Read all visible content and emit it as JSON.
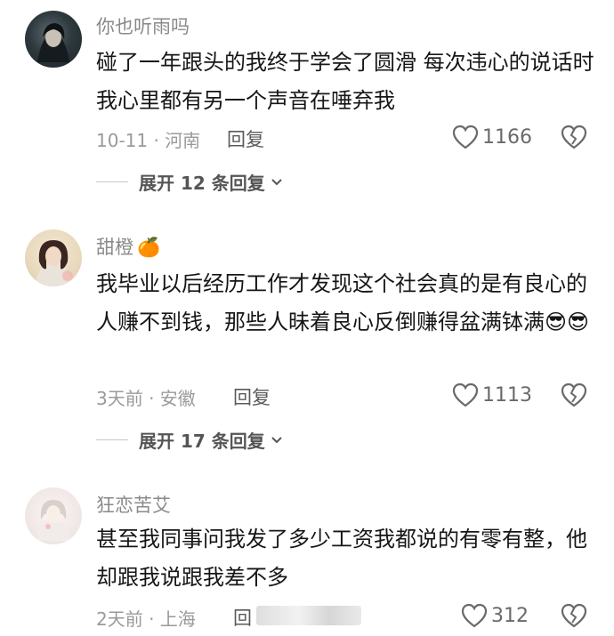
{
  "comments": [
    {
      "username": "你也听雨吗",
      "user_emoji": "",
      "text": "碰了一年跟头的我终于学会了圆滑 每次违心的说话时我心里都有另一个声音在唾弃我",
      "date_location": "10-11 · 河南",
      "reply_label": "回复",
      "likes": "1166",
      "expand_label": "展开 12 条回复"
    },
    {
      "username": "甜橙",
      "user_emoji": "🍊",
      "text": "我毕业以后经历工作才发现这个社会真的是有良心的人赚不到钱，那些人昧着良心反倒赚得盆满钵满😎😎",
      "date_location": "3天前 · 安徽",
      "reply_label": "回复",
      "likes": "1113",
      "expand_label": "展开 17 条回复"
    },
    {
      "username": "狂恋苦艾",
      "user_emoji": "",
      "text": "甚至我同事问我发了多少工资我都说的有零有整，他却跟我说跟我差不多",
      "date_location": "2天前 · 上海",
      "reply_label": "回",
      "likes": "312"
    }
  ],
  "icons": {
    "like": "heart-outline-icon",
    "dislike": "broken-heart-icon",
    "expand": "chevron-down-icon"
  },
  "colors": {
    "username": "#8a8a8a",
    "text": "#161616",
    "meta": "#9a9a9a"
  }
}
